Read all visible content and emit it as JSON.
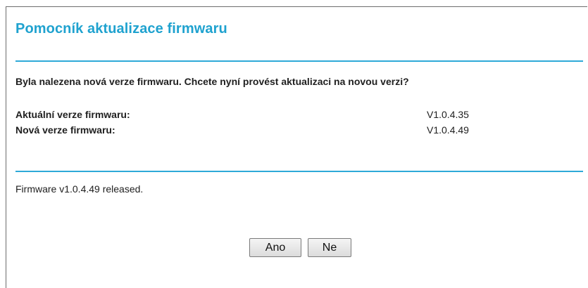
{
  "dialog": {
    "title": "Pomocník aktualizace firmwaru",
    "question": "Byla nalezena nová verze firmwaru. Chcete nyní provést aktualizaci na novou verzi?",
    "current_version_label": "Aktuální verze firmwaru:",
    "current_version_value": "V1.0.4.35",
    "new_version_label": "Nová verze firmwaru:",
    "new_version_value": "V1.0.4.49",
    "release_notes": "Firmware v1.0.4.49 released.",
    "yes_label": "Ano",
    "no_label": "Ne"
  },
  "colors": {
    "accent": "#1fa2cf",
    "rule": "#2ea9d8"
  }
}
